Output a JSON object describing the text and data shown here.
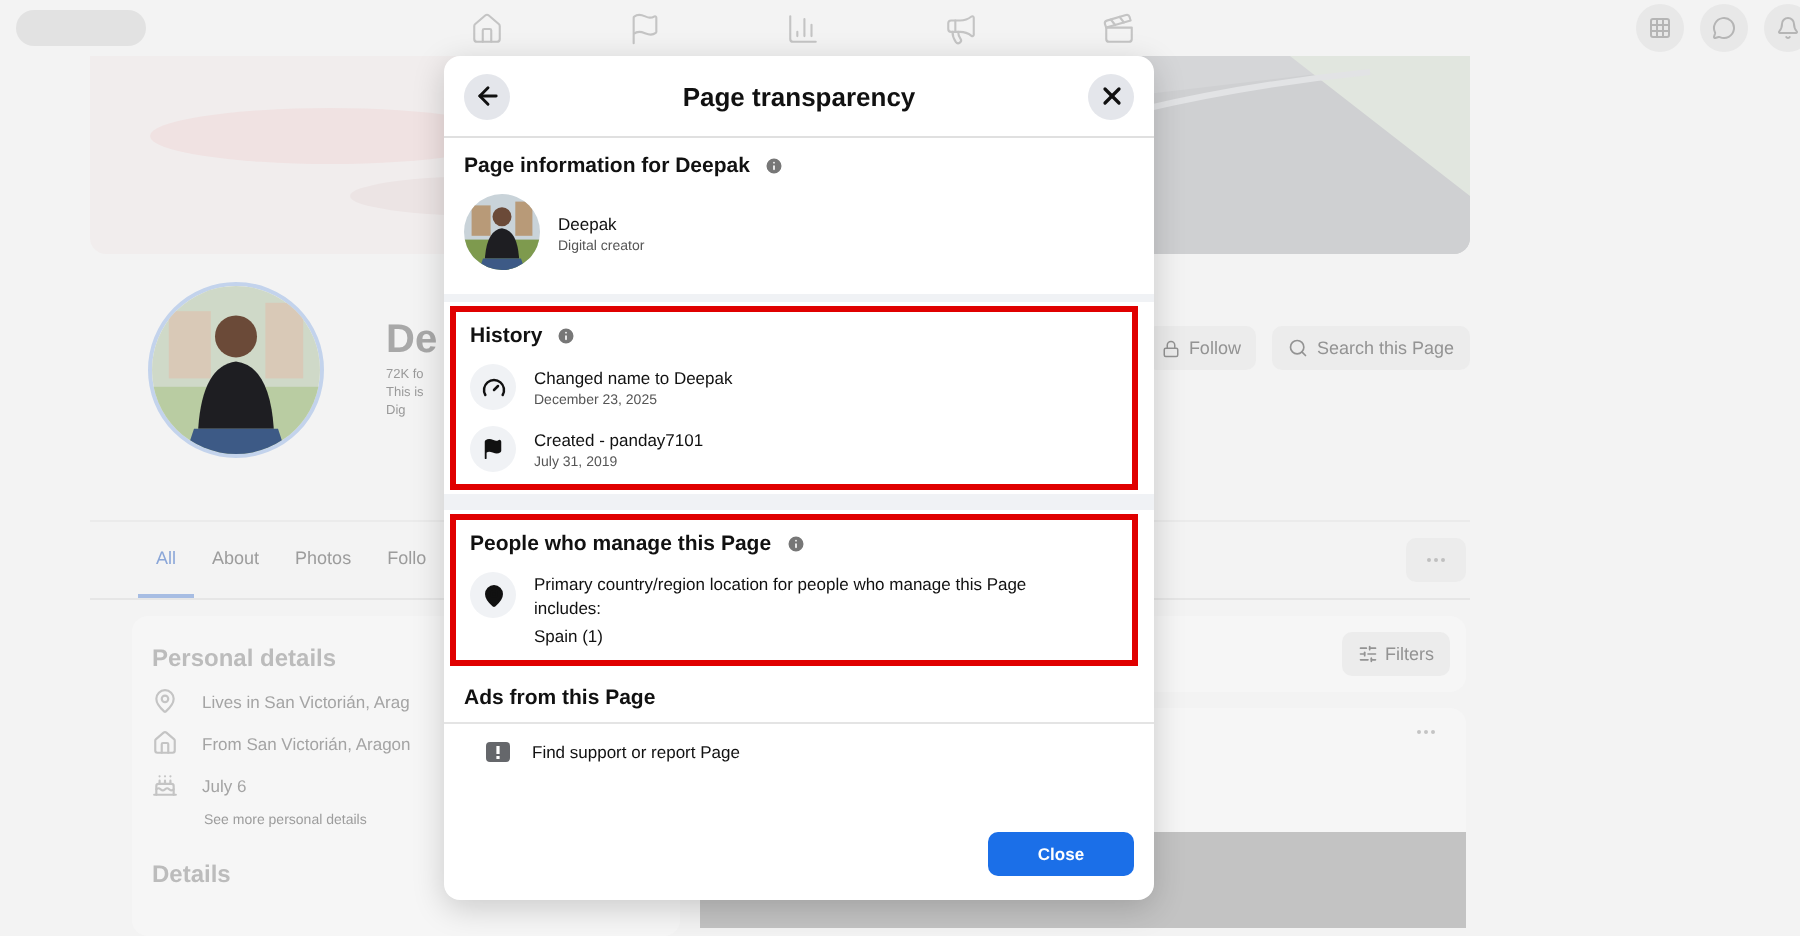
{
  "page": {
    "name": "De",
    "followers": "72K fo",
    "intro": "This is",
    "category": "Dig",
    "actions": [
      {
        "kind": "follow",
        "label": "Follow"
      },
      {
        "kind": "search",
        "label": "Search this Page"
      }
    ],
    "tabs": [
      {
        "label": "All",
        "selected": true
      },
      {
        "label": "About",
        "selected": false
      },
      {
        "label": "Photos",
        "selected": false
      },
      {
        "label": "Follo",
        "selected": false
      }
    ],
    "personal_details": {
      "title": "Personal details",
      "items": [
        {
          "kind": "location",
          "text": "Lives in San Victorián, Arag"
        },
        {
          "kind": "home",
          "text": "From San Victorián, Aragon"
        },
        {
          "kind": "birthday",
          "text": "July 6"
        }
      ],
      "link": "See more personal details"
    },
    "details_title": "Details",
    "filters": "Filters"
  },
  "dialog": {
    "title": "Page transparency",
    "info_title": "Page information for Deepak",
    "page_name": "Deepak",
    "page_category": "Digital creator",
    "history": {
      "title": "History",
      "highlighted": true,
      "items": [
        {
          "kind": "rename",
          "text": "Changed name to Deepak",
          "date": "December 23, 2025"
        },
        {
          "kind": "created",
          "text": "Created - panday7101",
          "date": "July 31, 2019"
        }
      ]
    },
    "managers": {
      "title": "People who manage this Page",
      "highlighted": true,
      "text": "Primary country/region location for people who manage this Page includes:",
      "value": "Spain (1)"
    },
    "ads_title": "Ads from this Page",
    "report": "Find support or report Page",
    "close_button": "Close"
  }
}
